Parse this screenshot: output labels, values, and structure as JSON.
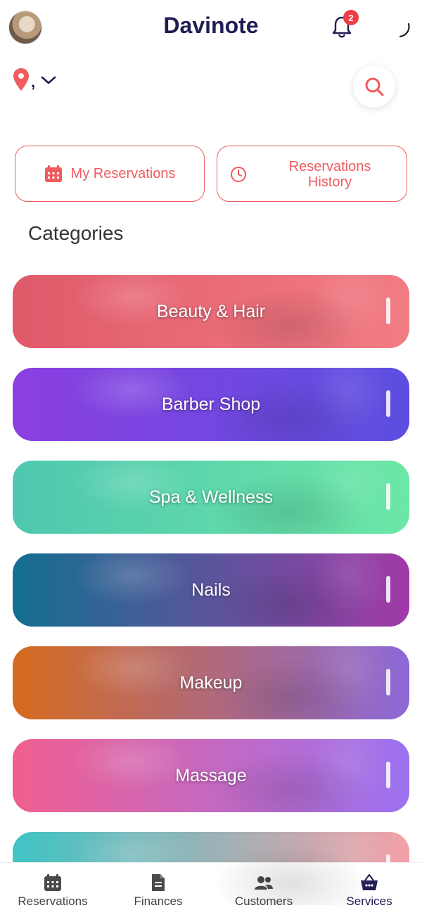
{
  "header": {
    "app_title": "Davinote",
    "notification_count": "2"
  },
  "location": {
    "text": ","
  },
  "actions": {
    "my_reservations": "My Reservations",
    "reservations_history_line1": "Reservations",
    "reservations_history_line2": "History"
  },
  "categories_title": "Categories",
  "categories": [
    {
      "label": "Beauty & Hair",
      "colors": [
        "#e05a6a",
        "#f27c84"
      ]
    },
    {
      "label": "Barber Shop",
      "colors": [
        "#8b3fe0",
        "#5b4fe0"
      ]
    },
    {
      "label": "Spa & Wellness",
      "colors": [
        "#4fc7b0",
        "#6ce7a6"
      ]
    },
    {
      "label": "Nails",
      "colors": [
        "#136f8f",
        "#a23aa8"
      ]
    },
    {
      "label": "Makeup",
      "colors": [
        "#d66b1e",
        "#8c69d8"
      ]
    },
    {
      "label": "Massage",
      "colors": [
        "#f05f8f",
        "#9b72f0"
      ]
    },
    {
      "label": "",
      "colors": [
        "#3fc4c4",
        "#f5a0a8"
      ]
    }
  ],
  "bottom_nav": [
    {
      "label": "Reservations",
      "icon": "calendar-icon"
    },
    {
      "label": "Finances",
      "icon": "document-icon"
    },
    {
      "label": "Customers",
      "icon": "users-icon"
    },
    {
      "label": "Services",
      "icon": "basket-icon"
    }
  ],
  "colors": {
    "brand_navy": "#1f1d52",
    "accent_red": "#ef5b5e",
    "badge_red": "#ef3e45"
  }
}
